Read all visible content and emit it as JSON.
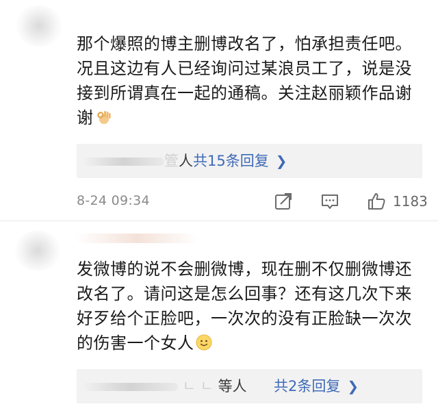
{
  "comments": [
    {
      "text": "那个爆照的博主删博改名了，怕承担责任吧。况且这边有人已经询问过某浪员工了，说是没接到所谓真在一起的通稿。关注赵丽颖作品谢谢",
      "emoji": "ok-hand-emoji",
      "reply_names_visible": "人",
      "reply_link": "共15条回复",
      "time": "8-24 09:34",
      "like_count": "1183"
    },
    {
      "text": "发微博的说不会删微博，现在删不仅删微博还改名了。请问这是怎么回事？还有这几次下来好歹给个正脸吧，一次次的没有正脸缺一次次的伤害一个女人",
      "emoji": "smile-emoji",
      "reply_names_visible": "等人",
      "reply_link": "共2条回复"
    }
  ],
  "icons": {
    "repost": "repost-icon",
    "comment": "comment-icon",
    "like": "like-icon",
    "chevron": "chevron-right-icon"
  },
  "colors": {
    "link": "#3f6ab7",
    "meta": "#8a8a8a",
    "reply_bg": "#f2f2f2"
  }
}
